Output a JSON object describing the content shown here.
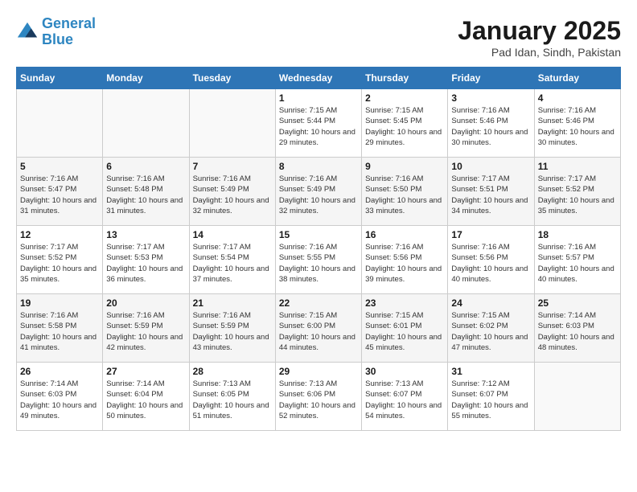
{
  "header": {
    "logo_line1": "General",
    "logo_line2": "Blue",
    "month_title": "January 2025",
    "location": "Pad Idan, Sindh, Pakistan"
  },
  "weekdays": [
    "Sunday",
    "Monday",
    "Tuesday",
    "Wednesday",
    "Thursday",
    "Friday",
    "Saturday"
  ],
  "weeks": [
    [
      {
        "day": "",
        "info": ""
      },
      {
        "day": "",
        "info": ""
      },
      {
        "day": "",
        "info": ""
      },
      {
        "day": "1",
        "info": "Sunrise: 7:15 AM\nSunset: 5:44 PM\nDaylight: 10 hours\nand 29 minutes."
      },
      {
        "day": "2",
        "info": "Sunrise: 7:15 AM\nSunset: 5:45 PM\nDaylight: 10 hours\nand 29 minutes."
      },
      {
        "day": "3",
        "info": "Sunrise: 7:16 AM\nSunset: 5:46 PM\nDaylight: 10 hours\nand 30 minutes."
      },
      {
        "day": "4",
        "info": "Sunrise: 7:16 AM\nSunset: 5:46 PM\nDaylight: 10 hours\nand 30 minutes."
      }
    ],
    [
      {
        "day": "5",
        "info": "Sunrise: 7:16 AM\nSunset: 5:47 PM\nDaylight: 10 hours\nand 31 minutes."
      },
      {
        "day": "6",
        "info": "Sunrise: 7:16 AM\nSunset: 5:48 PM\nDaylight: 10 hours\nand 31 minutes."
      },
      {
        "day": "7",
        "info": "Sunrise: 7:16 AM\nSunset: 5:49 PM\nDaylight: 10 hours\nand 32 minutes."
      },
      {
        "day": "8",
        "info": "Sunrise: 7:16 AM\nSunset: 5:49 PM\nDaylight: 10 hours\nand 32 minutes."
      },
      {
        "day": "9",
        "info": "Sunrise: 7:16 AM\nSunset: 5:50 PM\nDaylight: 10 hours\nand 33 minutes."
      },
      {
        "day": "10",
        "info": "Sunrise: 7:17 AM\nSunset: 5:51 PM\nDaylight: 10 hours\nand 34 minutes."
      },
      {
        "day": "11",
        "info": "Sunrise: 7:17 AM\nSunset: 5:52 PM\nDaylight: 10 hours\nand 35 minutes."
      }
    ],
    [
      {
        "day": "12",
        "info": "Sunrise: 7:17 AM\nSunset: 5:52 PM\nDaylight: 10 hours\nand 35 minutes."
      },
      {
        "day": "13",
        "info": "Sunrise: 7:17 AM\nSunset: 5:53 PM\nDaylight: 10 hours\nand 36 minutes."
      },
      {
        "day": "14",
        "info": "Sunrise: 7:17 AM\nSunset: 5:54 PM\nDaylight: 10 hours\nand 37 minutes."
      },
      {
        "day": "15",
        "info": "Sunrise: 7:16 AM\nSunset: 5:55 PM\nDaylight: 10 hours\nand 38 minutes."
      },
      {
        "day": "16",
        "info": "Sunrise: 7:16 AM\nSunset: 5:56 PM\nDaylight: 10 hours\nand 39 minutes."
      },
      {
        "day": "17",
        "info": "Sunrise: 7:16 AM\nSunset: 5:56 PM\nDaylight: 10 hours\nand 40 minutes."
      },
      {
        "day": "18",
        "info": "Sunrise: 7:16 AM\nSunset: 5:57 PM\nDaylight: 10 hours\nand 40 minutes."
      }
    ],
    [
      {
        "day": "19",
        "info": "Sunrise: 7:16 AM\nSunset: 5:58 PM\nDaylight: 10 hours\nand 41 minutes."
      },
      {
        "day": "20",
        "info": "Sunrise: 7:16 AM\nSunset: 5:59 PM\nDaylight: 10 hours\nand 42 minutes."
      },
      {
        "day": "21",
        "info": "Sunrise: 7:16 AM\nSunset: 5:59 PM\nDaylight: 10 hours\nand 43 minutes."
      },
      {
        "day": "22",
        "info": "Sunrise: 7:15 AM\nSunset: 6:00 PM\nDaylight: 10 hours\nand 44 minutes."
      },
      {
        "day": "23",
        "info": "Sunrise: 7:15 AM\nSunset: 6:01 PM\nDaylight: 10 hours\nand 45 minutes."
      },
      {
        "day": "24",
        "info": "Sunrise: 7:15 AM\nSunset: 6:02 PM\nDaylight: 10 hours\nand 47 minutes."
      },
      {
        "day": "25",
        "info": "Sunrise: 7:14 AM\nSunset: 6:03 PM\nDaylight: 10 hours\nand 48 minutes."
      }
    ],
    [
      {
        "day": "26",
        "info": "Sunrise: 7:14 AM\nSunset: 6:03 PM\nDaylight: 10 hours\nand 49 minutes."
      },
      {
        "day": "27",
        "info": "Sunrise: 7:14 AM\nSunset: 6:04 PM\nDaylight: 10 hours\nand 50 minutes."
      },
      {
        "day": "28",
        "info": "Sunrise: 7:13 AM\nSunset: 6:05 PM\nDaylight: 10 hours\nand 51 minutes."
      },
      {
        "day": "29",
        "info": "Sunrise: 7:13 AM\nSunset: 6:06 PM\nDaylight: 10 hours\nand 52 minutes."
      },
      {
        "day": "30",
        "info": "Sunrise: 7:13 AM\nSunset: 6:07 PM\nDaylight: 10 hours\nand 54 minutes."
      },
      {
        "day": "31",
        "info": "Sunrise: 7:12 AM\nSunset: 6:07 PM\nDaylight: 10 hours\nand 55 minutes."
      },
      {
        "day": "",
        "info": ""
      }
    ]
  ]
}
